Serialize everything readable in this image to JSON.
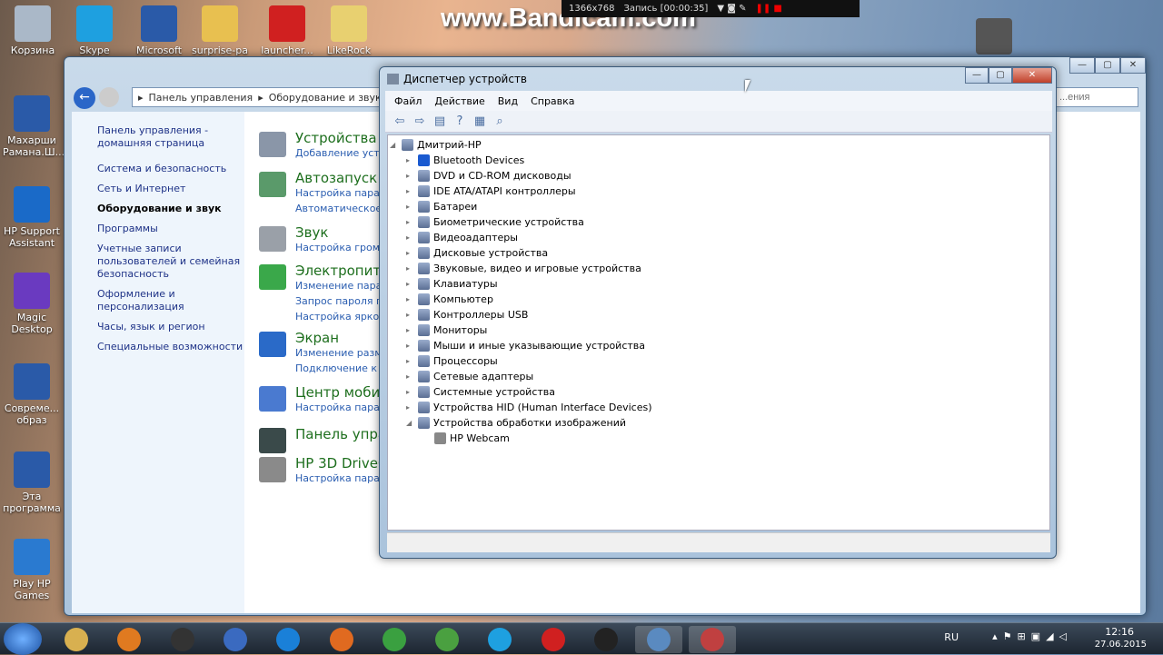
{
  "desktop": {
    "icons_top": [
      "Корзина",
      "Skype",
      "Microsoft",
      "surprise-pa",
      "launcher...",
      "LikeRock"
    ],
    "icons_left": [
      "Махарши Рамана.Ш...",
      "HP Support Assistant",
      "Magic Desktop",
      "Совреме... образ",
      "Эта программа",
      "Play HP Games"
    ]
  },
  "recorder": {
    "watermark": "www.Bandicam.com",
    "resolution": "1366x768",
    "status": "Запись [00:00:35]"
  },
  "control_panel": {
    "breadcrumb": [
      "Панель управления",
      "Оборудование и звук"
    ],
    "search_placeholder": "...ения",
    "nav": [
      "Панель управления - домашняя страница",
      "Система и безопасность",
      "Сеть и Интернет",
      "Оборудование и звук",
      "Программы",
      "Учетные записи пользователей и семейная безопасность",
      "Оформление и персонализация",
      "Часы, язык и регион",
      "Специальные возможности"
    ],
    "nav_current": 3,
    "categories": [
      {
        "title": "Устройства и",
        "links": [
          "Добавление устро"
        ],
        "color": "#8a96a8"
      },
      {
        "title": "Автозапуск",
        "links": [
          "Настройка парам",
          "Автоматическое"
        ],
        "color": "#5a9a6a"
      },
      {
        "title": "Звук",
        "links": [
          "Настройка громк"
        ],
        "color": "#9aa0a8"
      },
      {
        "title": "Электропитан",
        "links": [
          "Изменение парам",
          "Запрос пароля пр",
          "Настройка яркост"
        ],
        "color": "#3aa84a"
      },
      {
        "title": "Экран",
        "links": [
          "Изменение разме",
          "Подключение к п"
        ],
        "color": "#2a6ac8"
      },
      {
        "title": "Центр мобил",
        "links": [
          "Настройка парам"
        ],
        "color": "#4a7ad0"
      },
      {
        "title": "Панель управ",
        "links": [],
        "color": "#3a4a4a"
      },
      {
        "title": "HP 3D DriveG",
        "links": [
          "Настройка парам"
        ],
        "color": "#8a8a8a"
      }
    ]
  },
  "device_manager": {
    "title": "Диспетчер устройств",
    "menu": [
      "Файл",
      "Действие",
      "Вид",
      "Справка"
    ],
    "root": "Дмитрий-HP",
    "devices": [
      "Bluetooth Devices",
      "DVD и CD-ROM дисководы",
      "IDE ATA/ATAPI контроллеры",
      "Батареи",
      "Биометрические устройства",
      "Видеоадаптеры",
      "Дисковые устройства",
      "Звуковые, видео и игровые устройства",
      "Клавиатуры",
      "Компьютер",
      "Контроллеры USB",
      "Мониторы",
      "Мыши и иные указывающие устройства",
      "Процессоры",
      "Сетевые адаптеры",
      "Системные устройства",
      "Устройства HID (Human Interface Devices)",
      "Устройства обработки изображений"
    ],
    "expanded_child": "HP Webcam"
  },
  "taskbar": {
    "apps": [
      "explorer",
      "media-player",
      "hp",
      "check",
      "internet-explorer",
      "firefox",
      "chrome",
      "utorrent",
      "skype",
      "opera",
      "bandicam",
      "control-panel",
      "device-manager"
    ],
    "language": "RU",
    "time": "12:16",
    "date": "27.06.2015"
  }
}
